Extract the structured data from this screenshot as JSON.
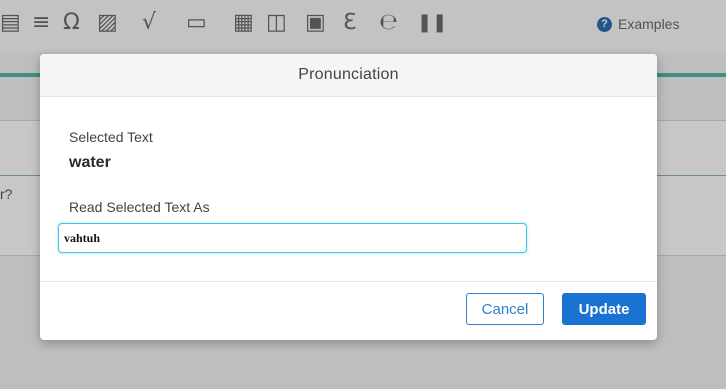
{
  "toolbar": {
    "icons": [
      {
        "name": "table-icon",
        "glyph": "▤"
      },
      {
        "name": "horizontal-rule-icon",
        "glyph": "≡"
      },
      {
        "name": "omega-icon",
        "glyph": "Ω"
      },
      {
        "name": "image-icon",
        "glyph": "▨"
      },
      {
        "name": "square-root-icon",
        "glyph": "√"
      },
      {
        "name": "keyboard-icon",
        "glyph": "▭"
      },
      {
        "name": "two-column-icon",
        "glyph": "▦"
      },
      {
        "name": "columns-icon",
        "glyph": "◫"
      },
      {
        "name": "audio-icon",
        "glyph": "▣"
      },
      {
        "name": "hearing-icon",
        "glyph": "ℇ"
      },
      {
        "name": "pronunciation-icon",
        "glyph": "℮"
      },
      {
        "name": "pause-icon",
        "glyph": "❚❚"
      }
    ],
    "examples_label": "Examples",
    "help_glyph": "?"
  },
  "background": {
    "question_fragment": "r?"
  },
  "modal": {
    "title": "Pronunciation",
    "selected_text_label": "Selected Text",
    "selected_text_value": "water",
    "read_as_label": "Read Selected Text As",
    "read_as_value": "vahtuh",
    "cancel_label": "Cancel",
    "update_label": "Update"
  },
  "colors": {
    "accent": "#1a73d2",
    "focus_ring": "#49c2e8",
    "teal_bar": "#54b6a7"
  }
}
